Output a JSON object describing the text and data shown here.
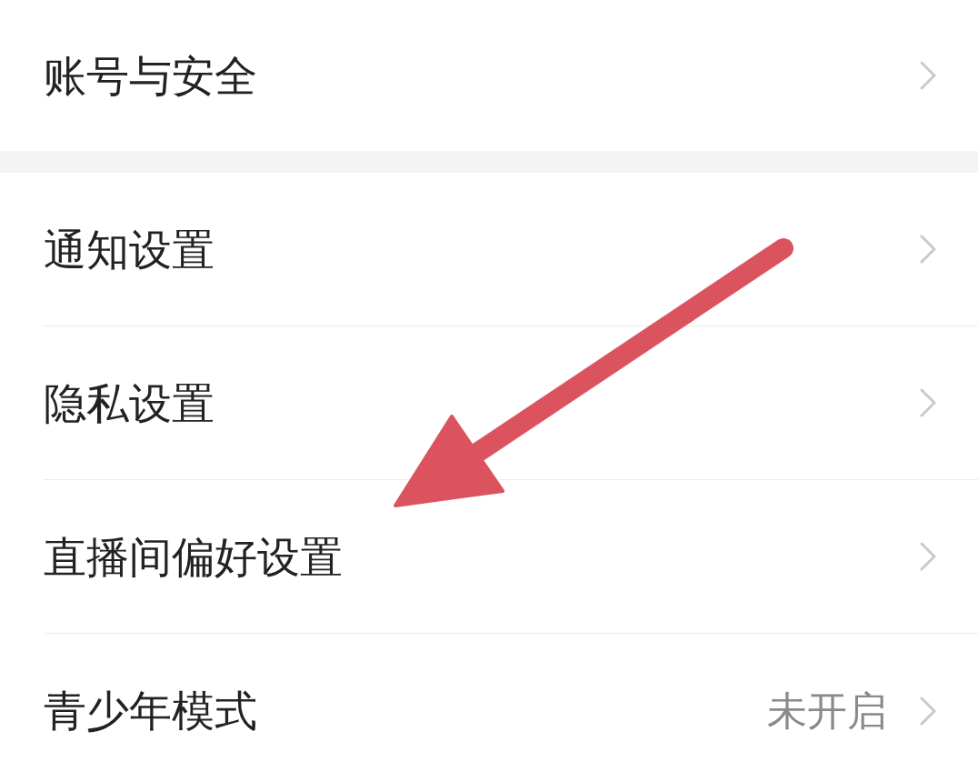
{
  "sections": [
    {
      "items": [
        {
          "label": "账号与安全"
        }
      ]
    },
    {
      "items": [
        {
          "label": "通知设置"
        },
        {
          "label": "隐私设置"
        },
        {
          "label": "直播间偏好设置"
        },
        {
          "label": "青少年模式",
          "value": "未开启"
        }
      ]
    }
  ]
}
